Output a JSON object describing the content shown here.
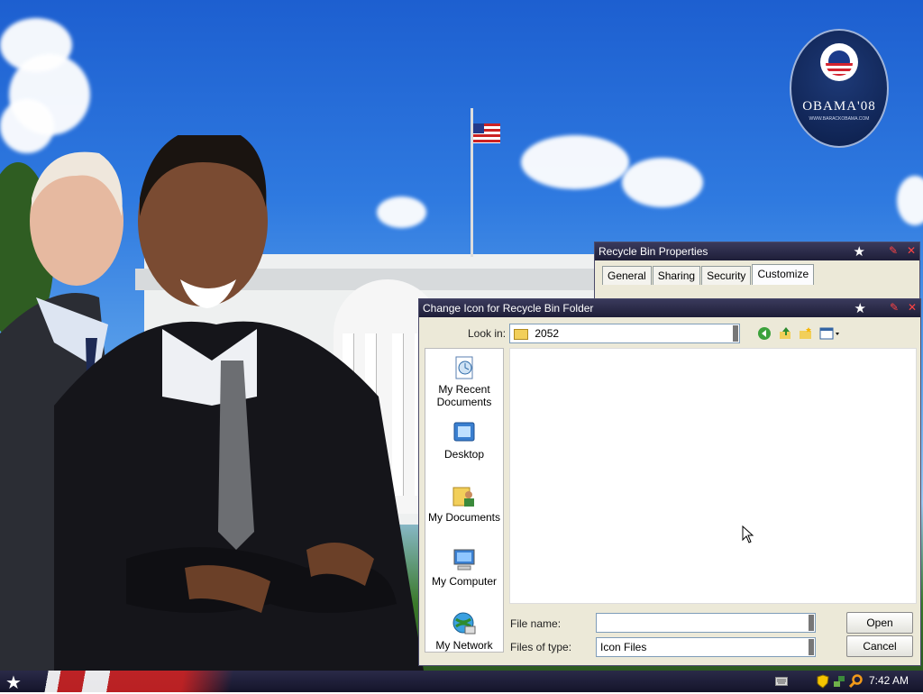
{
  "desktop": {
    "logo_text": "OBAMA'08",
    "logo_url": "WWW.BARACKOBAMA.COM"
  },
  "recycle_bin_window": {
    "title": "Recycle Bin Properties",
    "tabs": [
      "General",
      "Sharing",
      "Security",
      "Customize"
    ],
    "active_tab": "Customize"
  },
  "change_icon_dialog": {
    "title": "Change Icon for Recycle Bin Folder",
    "look_in_label": "Look in:",
    "look_in_value": "2052",
    "places": [
      {
        "label": "My Recent Documents",
        "icon": "recent-documents-icon"
      },
      {
        "label": "Desktop",
        "icon": "desktop-icon"
      },
      {
        "label": "My Documents",
        "icon": "my-documents-icon"
      },
      {
        "label": "My Computer",
        "icon": "my-computer-icon"
      },
      {
        "label": "My Network",
        "icon": "my-network-icon"
      }
    ],
    "file_name_label": "File name:",
    "file_name_value": "",
    "files_of_type_label": "Files of type:",
    "files_of_type_value": "Icon Files",
    "open_label": "Open",
    "cancel_label": "Cancel"
  },
  "taskbar": {
    "clock": "7:42 AM"
  }
}
